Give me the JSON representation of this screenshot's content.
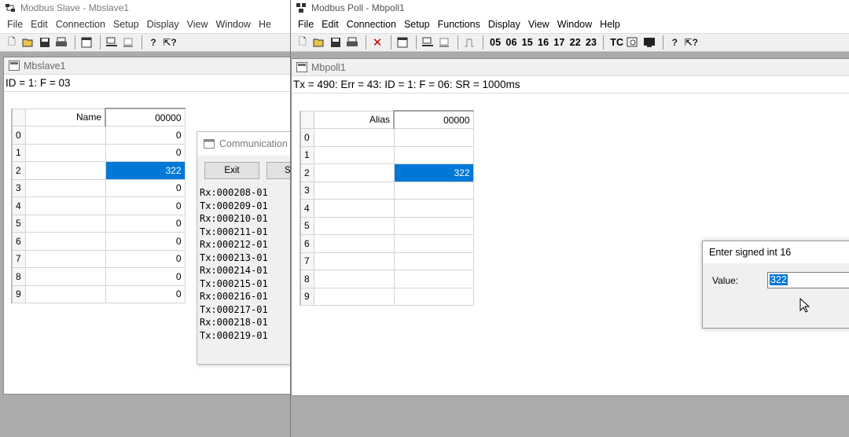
{
  "slave": {
    "title": "Modbus Slave - Mbslave1",
    "menu": [
      "File",
      "Edit",
      "Connection",
      "Setup",
      "Display",
      "View",
      "Window",
      "He"
    ],
    "child_title": "Mbslave1",
    "status": "ID = 1: F = 03",
    "table": {
      "name_header": "Name",
      "value_header": "00000",
      "rows": [
        {
          "n": "0",
          "v": "0"
        },
        {
          "n": "1",
          "v": "0"
        },
        {
          "n": "2",
          "v": "322"
        },
        {
          "n": "3",
          "v": "0"
        },
        {
          "n": "4",
          "v": "0"
        },
        {
          "n": "5",
          "v": "0"
        },
        {
          "n": "6",
          "v": "0"
        },
        {
          "n": "7",
          "v": "0"
        },
        {
          "n": "8",
          "v": "0"
        },
        {
          "n": "9",
          "v": "0"
        }
      ]
    },
    "comm": {
      "title": "Communication",
      "exit_label": "Exit",
      "second_label": "S",
      "log": [
        "Rx:000208-01",
        "Tx:000209-01",
        "Rx:000210-01",
        "Tx:000211-01",
        "Rx:000212-01",
        "Tx:000213-01",
        "Rx:000214-01",
        "Tx:000215-01",
        "Rx:000216-01",
        "Tx:000217-01",
        "Rx:000218-01",
        "Tx:000219-01"
      ]
    }
  },
  "poll": {
    "title": "Modbus Poll - Mbpoll1",
    "menu": [
      "File",
      "Edit",
      "Connection",
      "Setup",
      "Functions",
      "Display",
      "View",
      "Window",
      "Help"
    ],
    "toolbar_functions": [
      "05",
      "06",
      "15",
      "16",
      "17",
      "22",
      "23"
    ],
    "toolbar_tc": "TC",
    "child_title": "Mbpoll1",
    "status": "Tx = 490: Err = 43: ID = 1: F = 06: SR = 1000ms",
    "table": {
      "alias_header": "Alias",
      "value_header": "00000",
      "rows": [
        {
          "n": "0",
          "v": ""
        },
        {
          "n": "1",
          "v": ""
        },
        {
          "n": "2",
          "v": "322"
        },
        {
          "n": "3",
          "v": ""
        },
        {
          "n": "4",
          "v": ""
        },
        {
          "n": "5",
          "v": ""
        },
        {
          "n": "6",
          "v": ""
        },
        {
          "n": "7",
          "v": ""
        },
        {
          "n": "8",
          "v": ""
        },
        {
          "n": "9",
          "v": ""
        }
      ]
    }
  },
  "enter_dialog": {
    "title": "Enter signed int 16",
    "label": "Value:",
    "value": "322"
  },
  "colors": {
    "selection": "#0078d7",
    "workspace": "#ababab"
  }
}
